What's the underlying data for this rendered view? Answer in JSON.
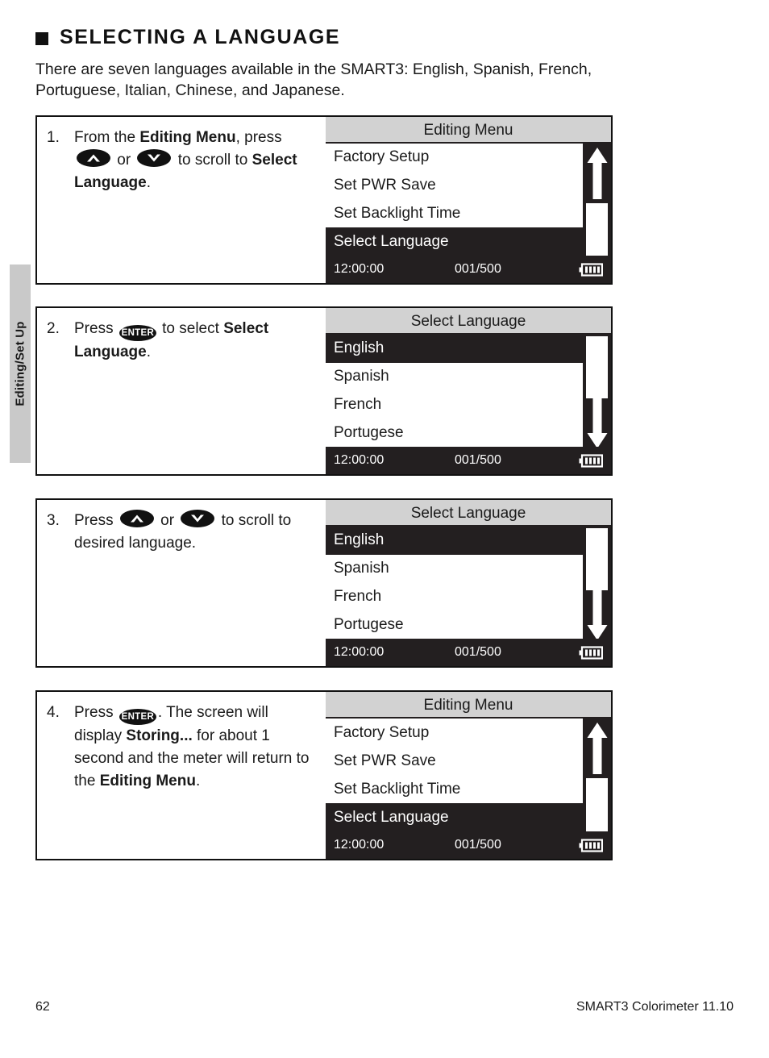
{
  "side_tab": {
    "label": "Editing/Set Up"
  },
  "heading": {
    "title": "SELECTING A LANGUAGE",
    "intro": "There are seven languages available in the SMART3: English, Spanish, French, Portuguese, Italian, Chinese, and Japanese."
  },
  "keys": {
    "enter_label": "ENTER",
    "up_label": "up-arrow-key",
    "down_label": "down-arrow-key"
  },
  "steps": [
    {
      "number": "1.",
      "text_parts": [
        {
          "t": "From the ",
          "b": false
        },
        {
          "t": "Editing Menu",
          "b": true
        },
        {
          "t": ", press ",
          "b": false
        },
        {
          "t": "KEY_UP",
          "b": false
        },
        {
          "t": " or ",
          "b": false
        },
        {
          "t": "KEY_DOWN",
          "b": false
        },
        {
          "t": " to scroll to ",
          "b": false
        },
        {
          "t": "Select Language",
          "b": true
        },
        {
          "t": ".",
          "b": false
        }
      ],
      "lcd": {
        "title": "Editing Menu",
        "rows": [
          {
            "label": "Factory Setup",
            "selected": false
          },
          {
            "label": "Set PWR Save",
            "selected": false
          },
          {
            "label": "Set Backlight Time",
            "selected": false
          },
          {
            "label": "Select Language",
            "selected": true
          }
        ],
        "scroll": {
          "arrow": "up",
          "thumb_position": "bottom"
        },
        "status": {
          "time": "12:00:00",
          "count": "001/500",
          "battery": "battery-full-icon"
        }
      }
    },
    {
      "number": "2.",
      "text_parts": [
        {
          "t": "Press ",
          "b": false
        },
        {
          "t": "KEY_ENTER",
          "b": false
        },
        {
          "t": " to select ",
          "b": false
        },
        {
          "t": "Select Language",
          "b": true
        },
        {
          "t": ".",
          "b": false
        }
      ],
      "lcd": {
        "title": "Select Language",
        "rows": [
          {
            "label": "English",
            "selected": true
          },
          {
            "label": "Spanish",
            "selected": false
          },
          {
            "label": "French",
            "selected": false
          },
          {
            "label": "Portugese",
            "selected": false
          }
        ],
        "scroll": {
          "arrow": "down",
          "thumb_position": "top"
        },
        "status": {
          "time": "12:00:00",
          "count": "001/500",
          "battery": "battery-full-icon"
        }
      }
    },
    {
      "number": "3.",
      "text_parts": [
        {
          "t": "Press ",
          "b": false
        },
        {
          "t": "KEY_UP",
          "b": false
        },
        {
          "t": " or ",
          "b": false
        },
        {
          "t": "KEY_DOWN",
          "b": false
        },
        {
          "t": " to scroll to desired language.",
          "b": false
        }
      ],
      "lcd": {
        "title": "Select Language",
        "rows": [
          {
            "label": "English",
            "selected": true
          },
          {
            "label": "Spanish",
            "selected": false
          },
          {
            "label": "French",
            "selected": false
          },
          {
            "label": "Portugese",
            "selected": false
          }
        ],
        "scroll": {
          "arrow": "down",
          "thumb_position": "top"
        },
        "status": {
          "time": "12:00:00",
          "count": "001/500",
          "battery": "battery-full-icon"
        }
      }
    },
    {
      "number": "4.",
      "text_parts": [
        {
          "t": "Press ",
          "b": false
        },
        {
          "t": "KEY_ENTER",
          "b": false
        },
        {
          "t": ". The screen will display ",
          "b": false
        },
        {
          "t": "Storing...",
          "b": true
        },
        {
          "t": " for about 1 second and the meter will return to the ",
          "b": false
        },
        {
          "t": "Editing Menu",
          "b": true
        },
        {
          "t": ".",
          "b": false
        }
      ],
      "lcd": {
        "title": "Editing Menu",
        "rows": [
          {
            "label": "Factory Setup",
            "selected": false
          },
          {
            "label": "Set PWR Save",
            "selected": false
          },
          {
            "label": "Set Backlight Time",
            "selected": false
          },
          {
            "label": "Select Language",
            "selected": true
          }
        ],
        "scroll": {
          "arrow": "up",
          "thumb_position": "bottom"
        },
        "status": {
          "time": "12:00:00",
          "count": "001/500",
          "battery": "battery-full-icon"
        }
      }
    }
  ],
  "footer": {
    "page_number": "62",
    "document_title": "SMART3 Colorimeter 11.10"
  }
}
